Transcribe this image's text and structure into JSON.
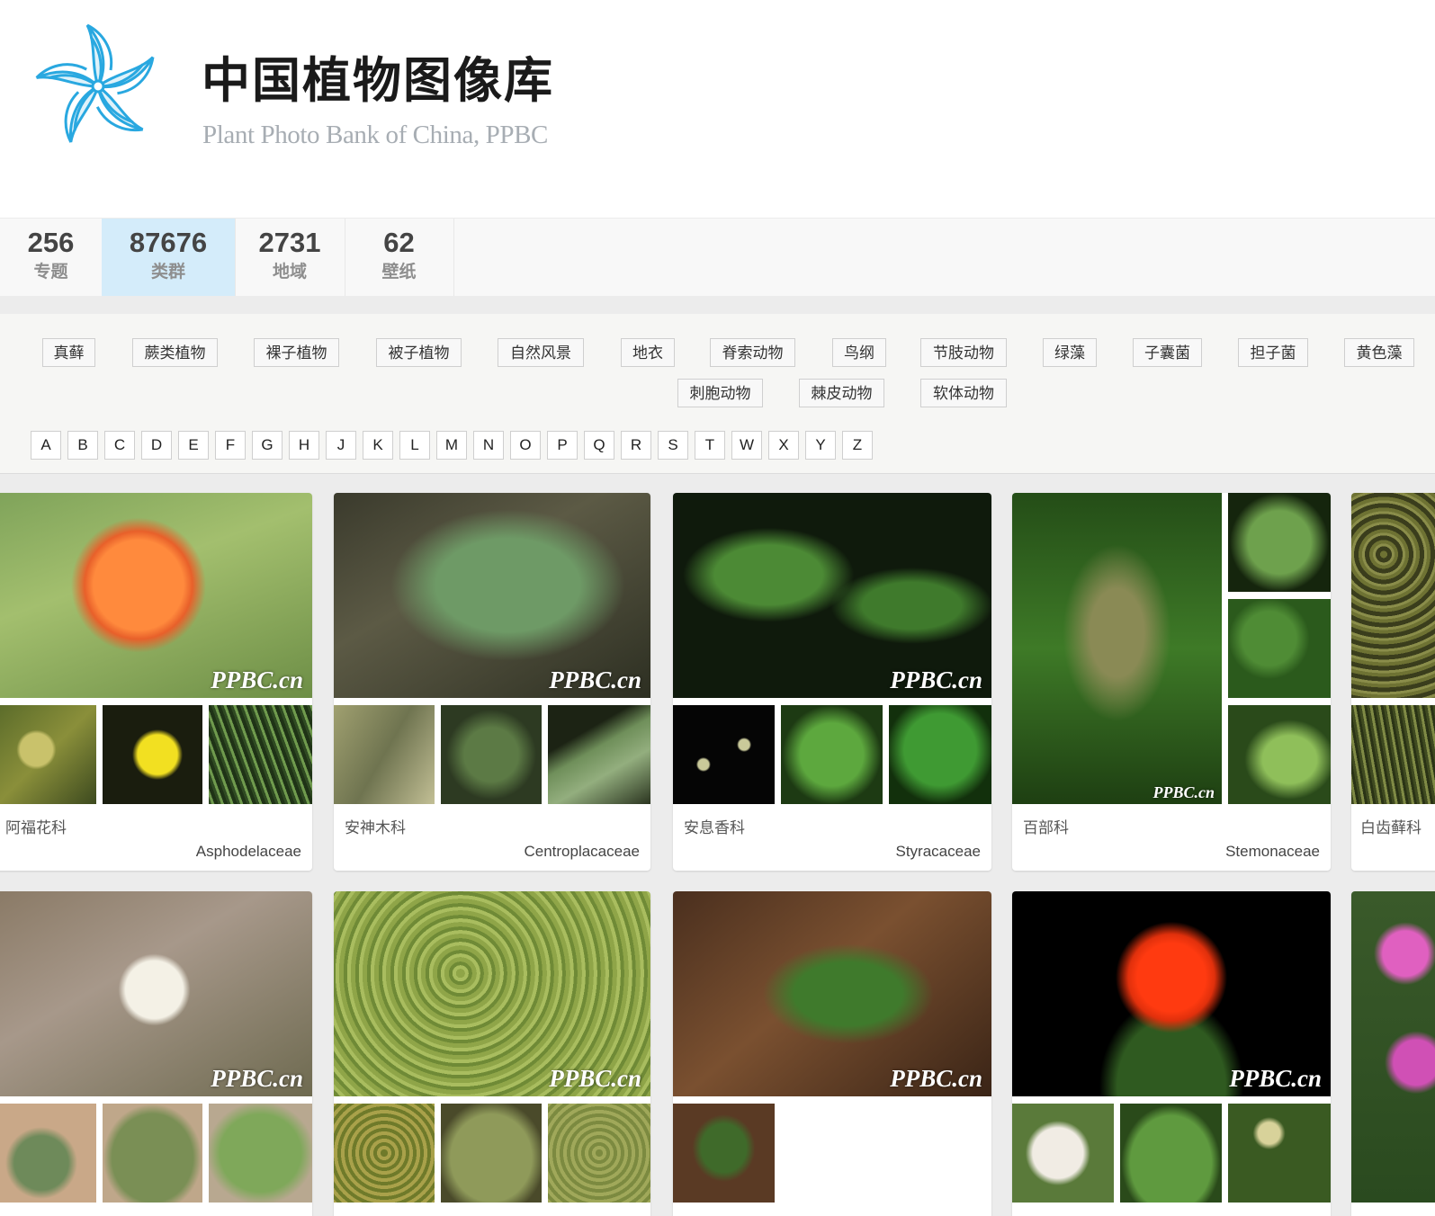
{
  "site": {
    "title": "中国植物图像库",
    "subtitle": "Plant Photo Bank of China, PPBC"
  },
  "stats": [
    {
      "num": "256",
      "label": "专题"
    },
    {
      "num": "87676",
      "label": "类群"
    },
    {
      "num": "2731",
      "label": "地域"
    },
    {
      "num": "62",
      "label": "壁纸"
    }
  ],
  "categories": [
    "真藓",
    "蕨类植物",
    "裸子植物",
    "被子植物",
    "自然风景",
    "地衣",
    "脊索动物",
    "鸟纲",
    "节肢动物",
    "绿藻",
    "子囊菌",
    "担子菌",
    "黄色藻",
    "刺胞动物",
    "棘皮动物",
    "软体动物"
  ],
  "letters": [
    "A",
    "B",
    "C",
    "D",
    "E",
    "F",
    "G",
    "H",
    "J",
    "K",
    "L",
    "M",
    "N",
    "O",
    "P",
    "Q",
    "R",
    "S",
    "T",
    "W",
    "X",
    "Y",
    "Z"
  ],
  "watermark": "PPBC.cn",
  "cards": [
    {
      "cn": "阿福花科",
      "latin": "Asphodelaceae"
    },
    {
      "cn": "安神木科",
      "latin": "Centroplacaceae"
    },
    {
      "cn": "安息香科",
      "latin": "Styracaceae"
    },
    {
      "cn": "百部科",
      "latin": "Stemonaceae"
    },
    {
      "cn": "白齿藓科",
      "latin": ""
    },
    {
      "cn": "",
      "latin": ""
    },
    {
      "cn": "",
      "latin": ""
    },
    {
      "cn": "",
      "latin": ""
    },
    {
      "cn": "",
      "latin": ""
    },
    {
      "cn": "",
      "latin": ""
    }
  ],
  "colors": {
    "accent": "#d4ecfa",
    "logo_blue": "#29a8e0",
    "subtitle_gray": "#a7adb3"
  }
}
